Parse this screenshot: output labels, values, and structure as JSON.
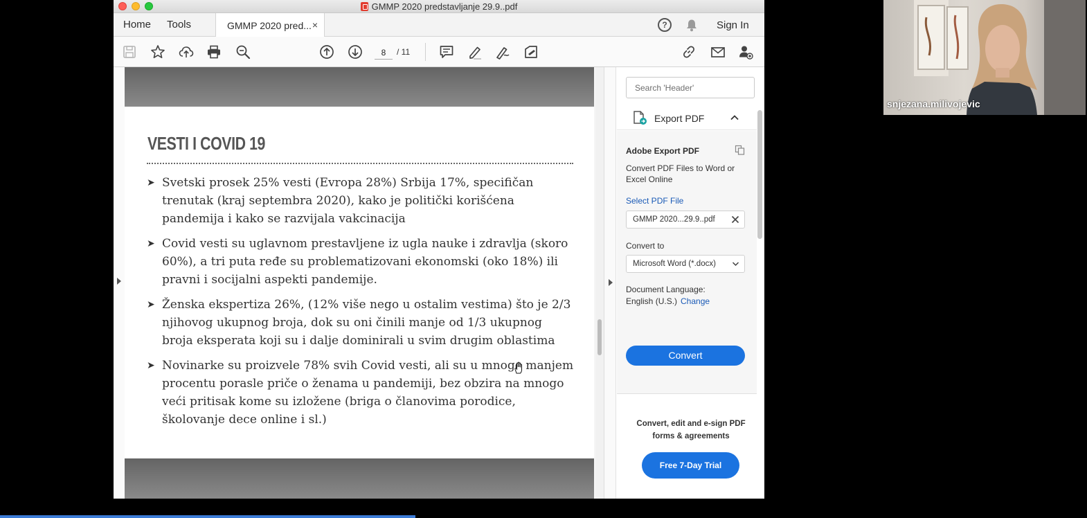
{
  "window": {
    "title": "GMMP 2020 predstavljanje 29.9..pdf"
  },
  "nav": {
    "home": "Home",
    "tools": "Tools",
    "doc_tab": "GMMP 2020 pred...",
    "close_glyph": "×",
    "help_glyph": "?",
    "sign_in": "Sign In"
  },
  "toolbar": {
    "page_current": "8",
    "page_total": "/ 11"
  },
  "slide": {
    "title": "VESTI I COVID 19",
    "bullets": [
      "Svetski prosek 25% vesti (Evropa 28%) Srbija 17%, specifičan trenutak (kraj septembra 2020), kako je politički korišćena pandemija i kako se razvijala vakcinacija",
      "Covid vesti su uglavnom prestavljene iz ugla nauke i zdravlja (skoro 60%), a tri puta ređe su problematizovani ekonomski (oko 18%) ili pravni i socijalni aspekti pandemije.",
      "Ženska ekspertiza 26%,  (12% više nego u ostalim vestima) što je 2/3 njihovog ukupnog broja, dok su oni činili  manje od 1/3 ukupnog broja eksperata  koji su i dalje dominirali u svim drugim oblastima",
      " Novinarke su proizvele 78% svih  Covid  vesti, ali su u mnogo manjem procentu porasle priče o ženama u pandemiji, bez obzira na mnogo veći pritisak kome su izložene (briga o  članovima porodice, školovanje dece online i sl.)"
    ]
  },
  "panel": {
    "search_placeholder": "Search 'Header'",
    "export_title": "Export PDF",
    "adobe_title": "Adobe Export PDF",
    "desc": "Convert PDF Files to Word or Excel Online",
    "select_file_label": "Select PDF File",
    "file_name": "GMMP 2020...29.9..pdf",
    "convert_to_label": "Convert to",
    "convert_to_value": "Microsoft Word (*.docx)",
    "language_label": "Document Language:",
    "language_value": "English (U.S.)",
    "change_link": "Change",
    "convert_button": "Convert",
    "promo": "Convert, edit and e-sign PDF forms & agreements",
    "trial_button": "Free 7-Day Trial"
  },
  "webcam": {
    "name": "snjezana.milivojevic"
  },
  "colors": {
    "accent": "#1b73e0",
    "link": "#1a5ab6"
  }
}
